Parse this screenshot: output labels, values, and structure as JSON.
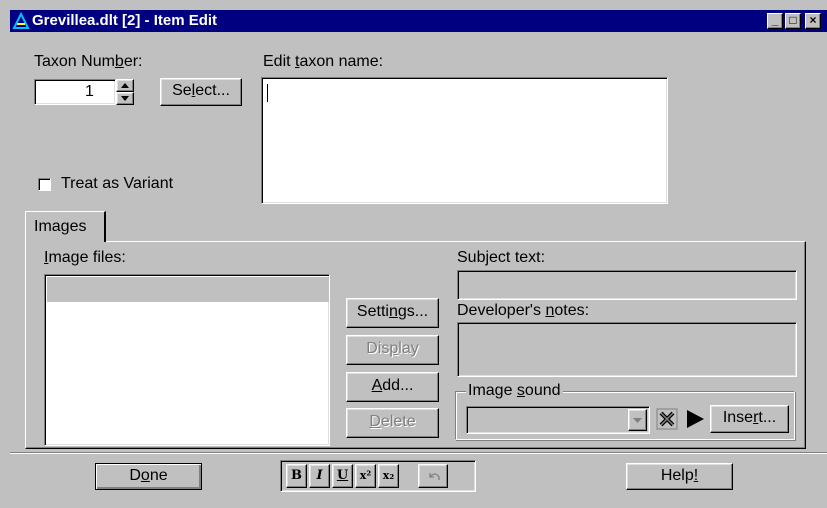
{
  "window": {
    "title": "Grevillea.dlt [2] - Item Edit",
    "minimize": "_",
    "maximize": "□",
    "close": "×"
  },
  "taxon": {
    "number_label": "Taxon Num",
    "number_label_u": "b",
    "number_label_post": "er:",
    "number_value": "1",
    "select_pre": "Se",
    "select_u": "l",
    "select_post": "ect...",
    "edit_label_pre": "Edit ",
    "edit_label_u": "t",
    "edit_label_post": "axon name:",
    "edit_value": "",
    "variant_label": "Treat as Variant"
  },
  "tabs": [
    {
      "label": "Images"
    }
  ],
  "images": {
    "files_label_u": "I",
    "files_label_post": "mage files:",
    "settings_pre": "Setti",
    "settings_u": "n",
    "settings_post": "gs...",
    "display_pre": "Dis",
    "display_u": "p",
    "display_post": "lay",
    "add_u": "A",
    "add_post": "dd...",
    "delete_u": "D",
    "delete_post": "elete",
    "subject_pre": "Sub",
    "subject_u": "j",
    "subject_post": "ect text:",
    "dev_pre": "Developer's ",
    "dev_u": "n",
    "dev_post": "otes:",
    "sound_pre": "Image ",
    "sound_u": "s",
    "sound_post": "ound",
    "insert_pre": "Inse",
    "insert_u": "r",
    "insert_post": "t..."
  },
  "footer": {
    "done_pre": "D",
    "done_u": "o",
    "done_post": "ne",
    "help_pre": "Help",
    "help_u": "!",
    "bold": "B",
    "italic": "I",
    "underline": "U",
    "superscript": "x²",
    "subscript": "x₂"
  },
  "colors": {
    "face": "#c0c0c0",
    "titlebar": "#000080",
    "shadow": "#808080"
  }
}
